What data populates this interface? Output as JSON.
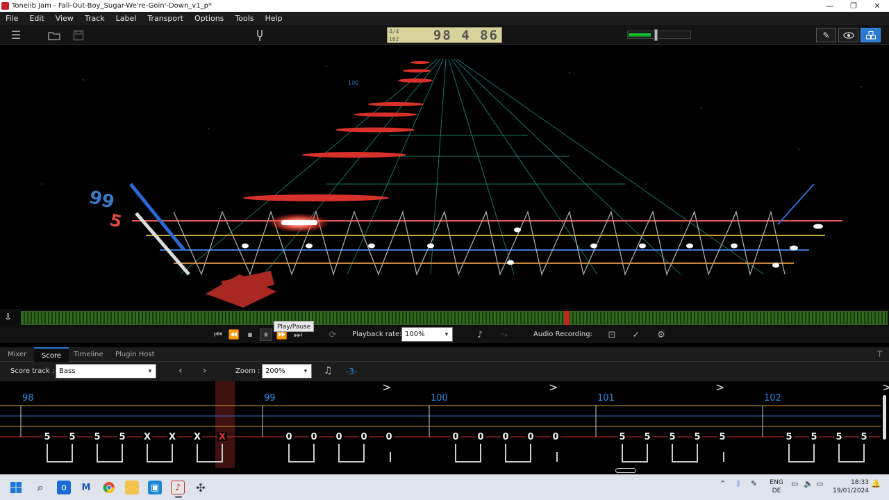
{
  "window": {
    "title": "Tonelib Jam - Fall-Out-Boy_Sugar-We're-Goin'-Down_v1_p*",
    "min": "—",
    "max": "❐",
    "close": "✕"
  },
  "menu": [
    "File",
    "Edit",
    "View",
    "Track",
    "Label",
    "Transport",
    "Options",
    "Tools",
    "Help"
  ],
  "toolbar": {
    "time_signature": "4/4",
    "tempo": "162",
    "position": "98 4 86",
    "volume_level": 0.45,
    "modes": [
      "edit-mode",
      "view-mode",
      "3d-mode"
    ]
  },
  "view3d": {
    "bar_labels": [
      "99",
      "100"
    ],
    "current_fret": "5"
  },
  "transport": {
    "tooltip": "Play/Pause",
    "playback_rate_label": "Playback rate:",
    "playback_rate": "100%",
    "audio_recording_label": "Audio Recording:"
  },
  "tabs": [
    {
      "label": "Mixer",
      "active": false
    },
    {
      "label": "Score",
      "active": true
    },
    {
      "label": "Timeline",
      "active": false
    },
    {
      "label": "Plugin Host",
      "active": false
    }
  ],
  "score_header": {
    "score_track_label": "Score track :",
    "score_track": "Bass",
    "zoom_label": "Zoom :",
    "zoom": "200%",
    "transpose": "-3-"
  },
  "score": {
    "measures": [
      {
        "number": "98",
        "notes": [
          "5",
          "5",
          "5",
          "5",
          "X",
          "X",
          "X",
          "X"
        ]
      },
      {
        "number": "99",
        "notes": [
          "0",
          "0",
          "0",
          "0",
          "0"
        ]
      },
      {
        "number": "100",
        "notes": [
          "0",
          "0",
          "0",
          "0",
          "0"
        ]
      },
      {
        "number": "101",
        "notes": [
          "5",
          "5",
          "5",
          "5",
          "5"
        ]
      },
      {
        "number": "102",
        "notes": [
          "5",
          "5",
          "5",
          "5"
        ]
      }
    ],
    "accent": ">"
  },
  "taskbar": {
    "language": "ENG",
    "layout": "DE",
    "time": "18:33",
    "date": "19/01/2024"
  },
  "colors": {
    "accent": "#2a7ad2",
    "string_red": "#e03a32",
    "string_yellow": "#d6b23a",
    "string_blue": "#3a78d6",
    "string_orange": "#d6803a",
    "fret_green": "#2aa88a"
  }
}
